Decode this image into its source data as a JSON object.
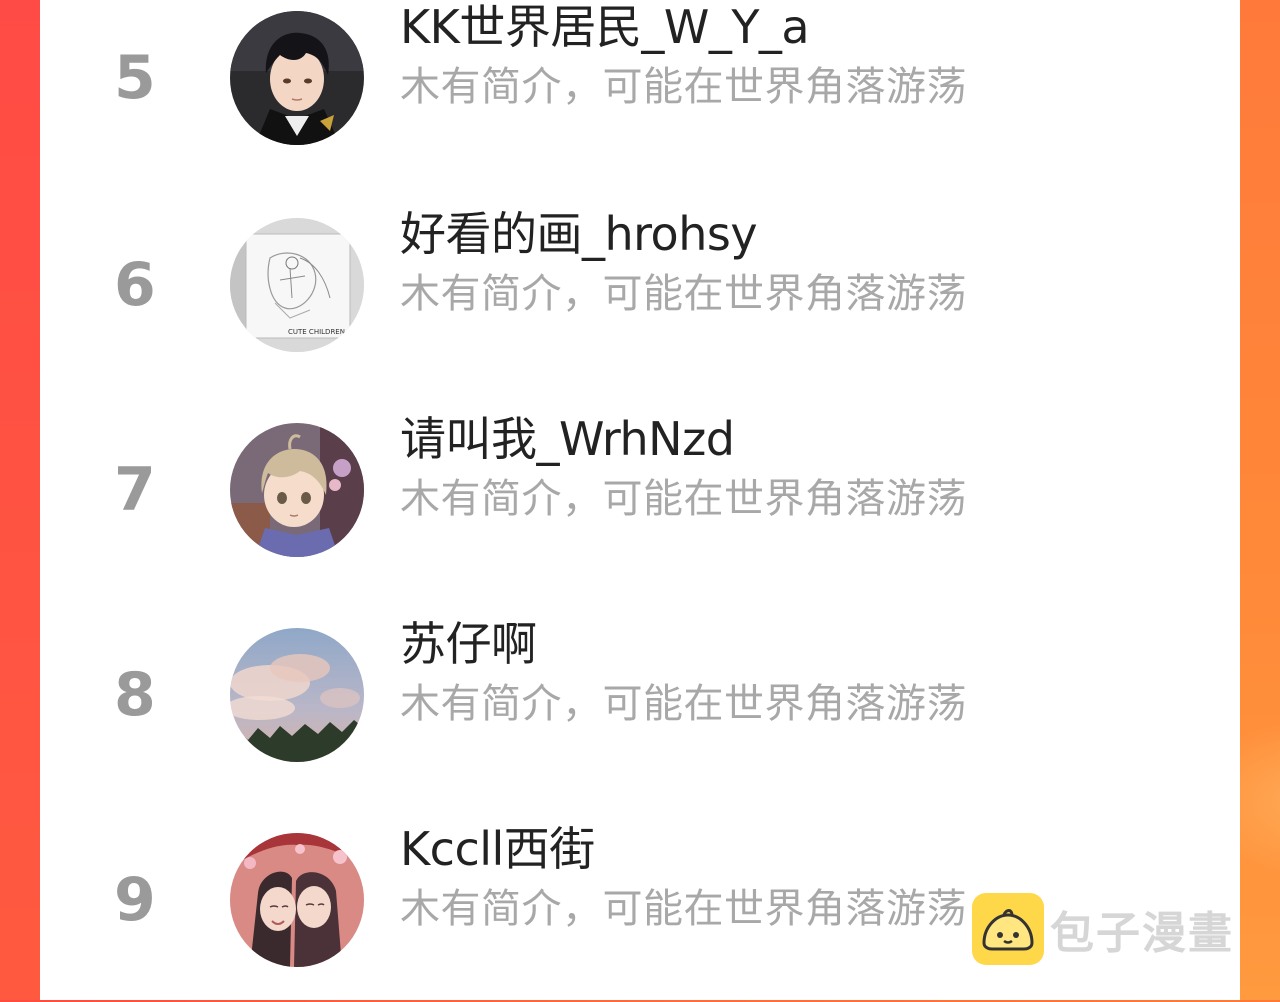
{
  "colors": {
    "rank_gray": "#9a9a9a",
    "name_text": "#222222",
    "bio_text": "#a8a8a8",
    "background_left": "#ff4a3e",
    "background_right": "#ff7a36",
    "watermark_icon": "#ffd84a"
  },
  "ranking": [
    {
      "rank": "5",
      "name": "KK世界居民_W_Y_a",
      "bio": "木有简介，可能在世界角落游荡",
      "avatar": "anime-boy-avatar"
    },
    {
      "rank": "6",
      "name": "好看的画_hrohsy",
      "bio": "木有简介，可能在世界角落游荡",
      "avatar": "sketch-drawing-avatar",
      "avatar_caption": "CUTE CHILDREN"
    },
    {
      "rank": "7",
      "name": "请叫我_WrhNzd",
      "bio": "木有简介，可能在世界角落游荡",
      "avatar": "anime-child-avatar"
    },
    {
      "rank": "8",
      "name": "苏仔啊",
      "bio": "木有简介，可能在世界角落游荡",
      "avatar": "sky-clouds-avatar"
    },
    {
      "rank": "9",
      "name": "Kccll西街",
      "bio": "木有简介，可能在世界角落游荡",
      "avatar": "anime-girls-avatar"
    }
  ],
  "watermark": {
    "text": "包子漫畫",
    "icon": "bun-logo-icon"
  }
}
